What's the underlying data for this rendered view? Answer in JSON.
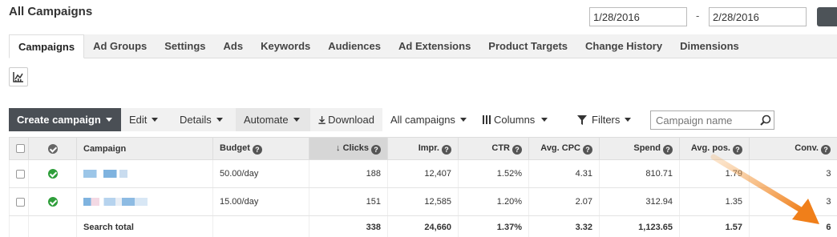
{
  "header": {
    "title": "All Campaigns",
    "date_start": "1/28/2016",
    "date_end": "2/28/2016",
    "date_separator": "-"
  },
  "tabs": [
    {
      "label": "Campaigns",
      "active": true
    },
    {
      "label": "Ad Groups"
    },
    {
      "label": "Settings"
    },
    {
      "label": "Ads"
    },
    {
      "label": "Keywords"
    },
    {
      "label": "Audiences"
    },
    {
      "label": "Ad Extensions"
    },
    {
      "label": "Product Targets"
    },
    {
      "label": "Change History"
    },
    {
      "label": "Dimensions"
    }
  ],
  "toolbar": {
    "create": "Create campaign",
    "edit": "Edit",
    "details": "Details",
    "automate": "Automate",
    "download": "Download",
    "all_campaigns": "All campaigns",
    "columns": "Columns",
    "filters": "Filters",
    "search_placeholder": "Campaign name"
  },
  "table": {
    "headers": {
      "campaign": "Campaign",
      "budget": "Budget",
      "clicks": "Clicks",
      "impr": "Impr.",
      "ctr": "CTR",
      "avg_cpc": "Avg. CPC",
      "spend": "Spend",
      "avg_pos": "Avg. pos.",
      "conv": "Conv."
    },
    "rows": [
      {
        "budget": "50.00/day",
        "clicks": "188",
        "impr": "12,407",
        "ctr": "1.52%",
        "avg_cpc": "4.31",
        "spend": "810.71",
        "avg_pos": "1.79",
        "conv": "3"
      },
      {
        "budget": "15.00/day",
        "clicks": "151",
        "impr": "12,585",
        "ctr": "1.20%",
        "avg_cpc": "2.07",
        "spend": "312.94",
        "avg_pos": "1.35",
        "conv": "3"
      }
    ],
    "total": {
      "label": "Search total",
      "clicks": "338",
      "impr": "24,660",
      "ctr": "1.37%",
      "avg_cpc": "3.32",
      "spend": "1,123.65",
      "avg_pos": "1.57",
      "conv": "6"
    }
  },
  "colors": {
    "accent_arrow": "#f08a24",
    "status_enabled": "#2e9e3a",
    "primary_button": "#4a4f55"
  }
}
